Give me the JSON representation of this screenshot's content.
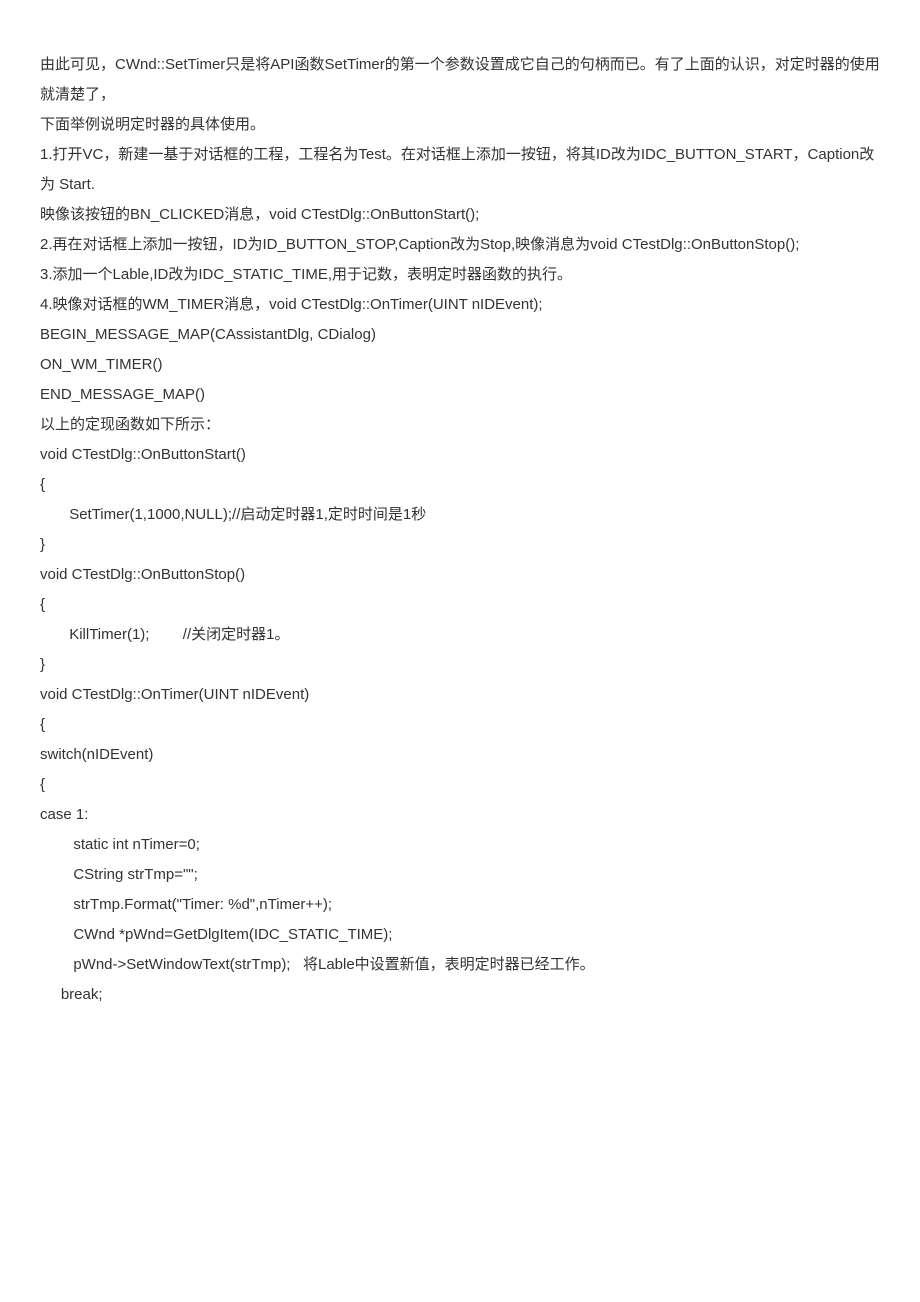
{
  "lines": [
    "由此可见，CWnd::SetTimer只是将API函数SetTimer的第一个参数设置成它自己的句柄而已。有了上面的认识，对定时器的使用就清楚了，",
    "下面举例说明定时器的具体使用。",
    "1.打开VC，新建一基于对话框的工程，工程名为Test。在对话框上添加一按钮，将其ID改为IDC_BUTTON_START，Caption改为 Start.",
    "映像该按钮的BN_CLICKED消息，void CTestDlg::OnButtonStart();",
    "2.再在对话框上添加一按钮，ID为ID_BUTTON_STOP,Caption改为Stop,映像消息为void CTestDlg::OnButtonStop();",
    "3.添加一个Lable,ID改为IDC_STATIC_TIME,用于记数，表明定时器函数的执行。",
    "4.映像对话框的WM_TIMER消息，void CTestDlg::OnTimer(UINT nIDEvent);",
    "",
    "",
    "BEGIN_MESSAGE_MAP(CAssistantDlg, CDialog)",
    "ON_WM_TIMER()",
    "END_MESSAGE_MAP()",
    "以上的定现函数如下所示：",
    "void CTestDlg::OnButtonStart()",
    "{",
    "       SetTimer(1,1000,NULL);//启动定时器1,定时时间是1秒",
    "}",
    "",
    "void CTestDlg::OnButtonStop()",
    "{",
    "       KillTimer(1);        //关闭定时器1。",
    "}",
    "",
    "void CTestDlg::OnTimer(UINT nIDEvent)",
    "{",
    "switch(nIDEvent)",
    "{",
    "case 1:",
    "        static int nTimer=0;",
    "        CString strTmp=\"\";",
    "        strTmp.Format(\"Timer: %d\",nTimer++);",
    "        CWnd *pWnd=GetDlgItem(IDC_STATIC_TIME);",
    "        pWnd->SetWindowText(strTmp);   将Lable中设置新值，表明定时器已经工作。",
    "     break;"
  ]
}
